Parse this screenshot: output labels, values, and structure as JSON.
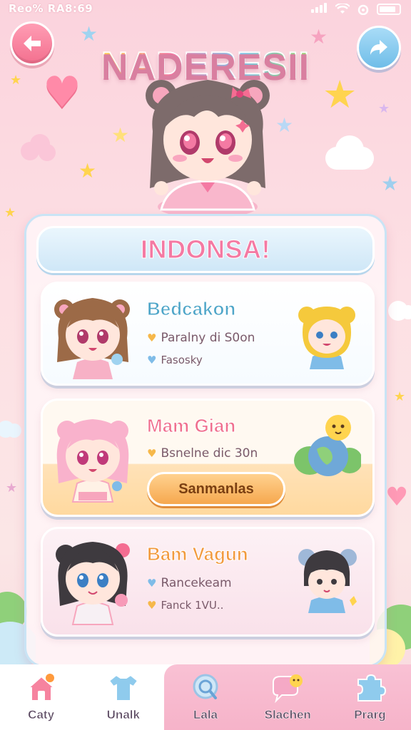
{
  "status": {
    "time": "Reo% RA8:69"
  },
  "header": {
    "title": "NADERESII"
  },
  "panel": {
    "title": "INDONSA!"
  },
  "cards": [
    {
      "name": "Bedcakon",
      "name_color": "#4fa6c9",
      "line1": "Paralny di S0on",
      "line2": "Fasosky",
      "icon1": "yellow-heart-icon",
      "icon2": "blue-heart-icon"
    },
    {
      "name": "Mam Gian",
      "name_color": "#f0708f",
      "line1": "Bsnelne dic 30n",
      "button": "Sanmanlas",
      "icon1": "yellow-heart-icon"
    },
    {
      "name": "Bam Vagun",
      "name_color": "#f29a3e",
      "line1": "Rancekeam",
      "line2": "Fanck 1VU..",
      "icon1": "blue-heart-icon",
      "icon2": "yellow-heart-icon"
    }
  ],
  "tabs": [
    {
      "label": "Caty",
      "icon": "home-icon"
    },
    {
      "label": "Unalk",
      "icon": "shirt-icon"
    },
    {
      "label": "Lala",
      "icon": "search-icon"
    },
    {
      "label": "Slachen",
      "icon": "chat-bubble-icon"
    },
    {
      "label": "Prarg",
      "icon": "puzzle-icon"
    }
  ],
  "colors": {
    "accent_pink": "#f47aa3",
    "accent_blue": "#6fbde8",
    "button_orange": "#f6a84e"
  }
}
